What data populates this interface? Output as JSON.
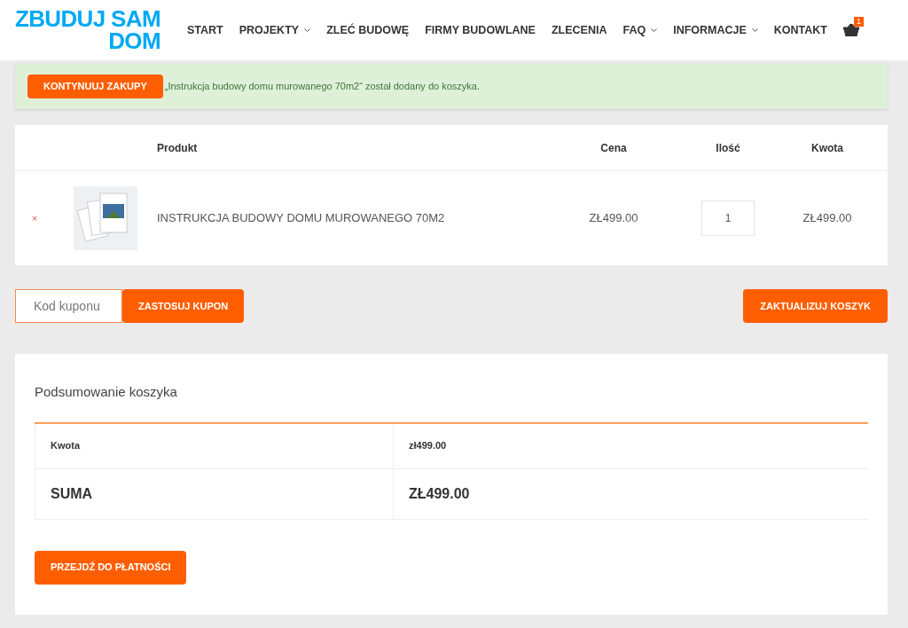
{
  "logo": {
    "line1": "ZBUDUJ SAM",
    "line2": "DOM"
  },
  "nav": [
    {
      "label": "START",
      "dropdown": false
    },
    {
      "label": "PROJEKTY",
      "dropdown": true
    },
    {
      "label": "ZLEĆ BUDOWĘ",
      "dropdown": false
    },
    {
      "label": "FIRMY BUDOWLANE",
      "dropdown": false
    },
    {
      "label": "ZLECENIA",
      "dropdown": false
    },
    {
      "label": "FAQ",
      "dropdown": true
    },
    {
      "label": "INFORMACJE",
      "dropdown": true
    },
    {
      "label": "KONTAKT",
      "dropdown": false
    }
  ],
  "cart_count": "1",
  "notice": {
    "button": "KONTYNUUJ ZAKUPY",
    "message": "„Instrukcja budowy domu murowanego 70m2“ został dodany do koszyka."
  },
  "cart": {
    "columns": [
      "Produkt",
      "Cena",
      "Ilość",
      "Kwota"
    ],
    "rows": [
      {
        "remove": "×",
        "product": "INSTRUKCJA BUDOWY DOMU MUROWANEGO 70M2",
        "price": "ZŁ499.00",
        "quantity": "1",
        "subtotal": "ZŁ499.00"
      }
    ]
  },
  "coupon": {
    "placeholder": "Kod kuponu",
    "apply": "ZASTOSUJ KUPON",
    "update": "ZAKTUALIZUJ KOSZYK"
  },
  "totals": {
    "title": "Podsumowanie koszyka",
    "rows": [
      {
        "kind": "subtotal",
        "label": "Kwota",
        "value": "zł499.00"
      },
      {
        "kind": "total",
        "label": "SUMA",
        "value": "ZŁ499.00"
      }
    ],
    "checkout": "PRZEJDŹ DO PŁATNOŚCI"
  }
}
